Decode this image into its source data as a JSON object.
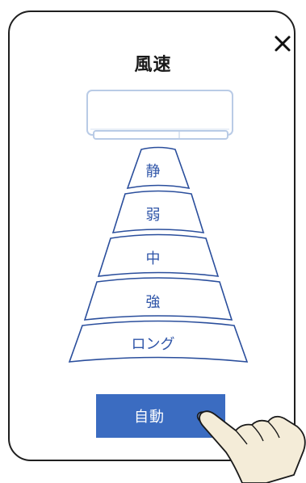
{
  "dialog": {
    "title": "風速",
    "close_symbol": "✕"
  },
  "fan_speeds": [
    {
      "label": "静"
    },
    {
      "label": "弱"
    },
    {
      "label": "中"
    },
    {
      "label": "強"
    },
    {
      "label": "ロング"
    }
  ],
  "auto_button": {
    "label": "自動"
  },
  "colors": {
    "accent": "#3b6cc1",
    "segment_text": "#2f55a8",
    "outline": "#2a4e9c",
    "hand_fill": "#f4ecd8"
  },
  "icons": {
    "close": "close-icon",
    "air_conditioner": "air-conditioner-icon",
    "hand_pointer": "hand-pointer-icon"
  }
}
